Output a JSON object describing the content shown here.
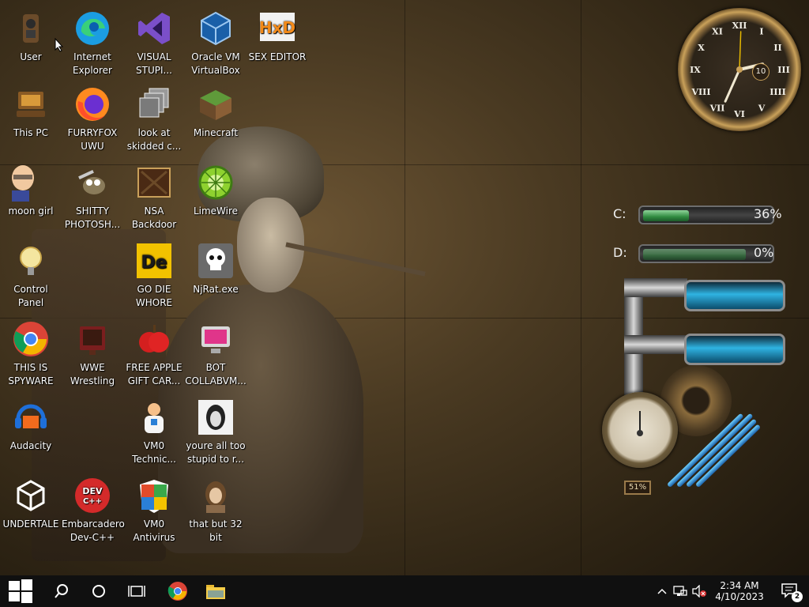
{
  "desktop": {
    "icons": [
      {
        "label": "User",
        "icon": "user-folder-icon"
      },
      {
        "label": "Internet Explorer",
        "icon": "edge-icon"
      },
      {
        "label": "VISUAL STUPI...",
        "icon": "visual-studio-icon"
      },
      {
        "label": "Oracle VM VirtualBox",
        "icon": "virtualbox-icon"
      },
      {
        "label": "SEX EDITOR",
        "icon": "hxd-icon"
      },
      {
        "label": "This PC",
        "icon": "this-pc-icon"
      },
      {
        "label": "FURRYFOX UWU",
        "icon": "firefox-icon"
      },
      {
        "label": "look at skidded c...",
        "icon": "windows-stack-icon"
      },
      {
        "label": "Minecraft",
        "icon": "minecraft-icon"
      },
      {
        "label": "moon girl",
        "icon": "cartoon-man-icon"
      },
      {
        "label": "SHITTY PHOTOSH...",
        "icon": "gimp-icon"
      },
      {
        "label": "NSA Backdoor",
        "icon": "nsa-backdoor-icon"
      },
      {
        "label": "LimeWire",
        "icon": "limewire-icon"
      },
      {
        "label": "GO DIE WHORE",
        "icon": "de-icon"
      },
      {
        "label": "NjRat.exe",
        "icon": "skull-icon"
      },
      {
        "label": "Control Panel",
        "icon": "control-panel-icon"
      },
      {
        "label": "THIS IS SPYWARE",
        "icon": "chrome-icon"
      },
      {
        "label": "WWE Wrestling",
        "icon": "wwe-icon"
      },
      {
        "label": "FREE APPLE GIFT CAR...",
        "icon": "apple-icon"
      },
      {
        "label": "BOT COLLABVM...",
        "icon": "bot-collabvm-icon"
      },
      {
        "label": "Audacity",
        "icon": "audacity-icon"
      },
      {
        "label": "VM0 Technic...",
        "icon": "technician-icon"
      },
      {
        "label": "youre all too stupid to r...",
        "icon": "portrait-icon"
      },
      {
        "label": "UNDERTALE",
        "icon": "unity-icon"
      },
      {
        "label": "Embarcadero Dev-C++",
        "icon": "devcpp-icon"
      },
      {
        "label": "VM0 Antivirus",
        "icon": "shield-icon"
      },
      {
        "label": "that but 32 bit",
        "icon": "portrait-icon"
      }
    ]
  },
  "widgets": {
    "clock": {
      "numerals": [
        "XII",
        "I",
        "II",
        "III",
        "IIII",
        "V",
        "VI",
        "VII",
        "VIII",
        "IX",
        "X",
        "XI"
      ],
      "date_badge": "10"
    },
    "disks": [
      {
        "label": "C:",
        "percent_text": "36%",
        "fill": 0.36
      },
      {
        "label": "D:",
        "percent_text": "0%",
        "fill": 0.0
      }
    ],
    "gauge": {
      "percent_text": "51%",
      "fill": 0.51
    }
  },
  "taskbar": {
    "time": "2:34 AM",
    "date": "4/10/2023",
    "notification_count": "2",
    "pinned": [
      "chrome-icon",
      "file-explorer-icon"
    ]
  },
  "colors": {
    "taskbar": "#101010",
    "disk_fill": "#2f8a3f",
    "tank": "#2fb3e2"
  }
}
